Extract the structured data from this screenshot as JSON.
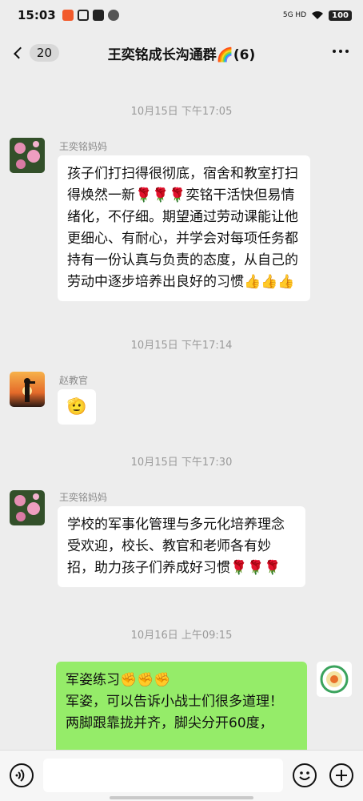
{
  "status_bar": {
    "time": "15:03",
    "network": "5G HD",
    "battery": "100"
  },
  "header": {
    "back_count": "20",
    "title": "王奕铭成长沟通群🌈(6)"
  },
  "messages": [
    {
      "timestamp": "10月15日 下午17:05",
      "sender": "王奕铭妈妈",
      "text": "孩子们打扫得很彻底，宿舍和教室打扫得焕然一新🌹🌹🌹奕铭干活快但易情绪化，不仔细。期望通过劳动课能让他更细心、有耐心，并学会对每项任务都持有一份认真与负责的态度，从自己的劳动中逐步培养出良好的习惯👍👍👍"
    },
    {
      "timestamp": "10月15日 下午17:14",
      "sender": "赵教官",
      "text": "🫡"
    },
    {
      "timestamp": "10月15日 下午17:30",
      "sender": "王奕铭妈妈",
      "text": "学校的军事化管理与多元化培养理念受欢迎，校长、教官和老师各有妙招，助力孩子们养成好习惯🌹🌹🌹"
    },
    {
      "timestamp": "10月16日 上午09:15",
      "sender": "",
      "text": "军姿练习✊✊✊\n军姿，可以告诉小战士们很多道理！\n两脚跟靠拢并齐，脚尖分开60度，"
    }
  ],
  "colors": {
    "background": "#ededed",
    "own_bubble": "#95ec69",
    "other_bubble": "#ffffff"
  }
}
